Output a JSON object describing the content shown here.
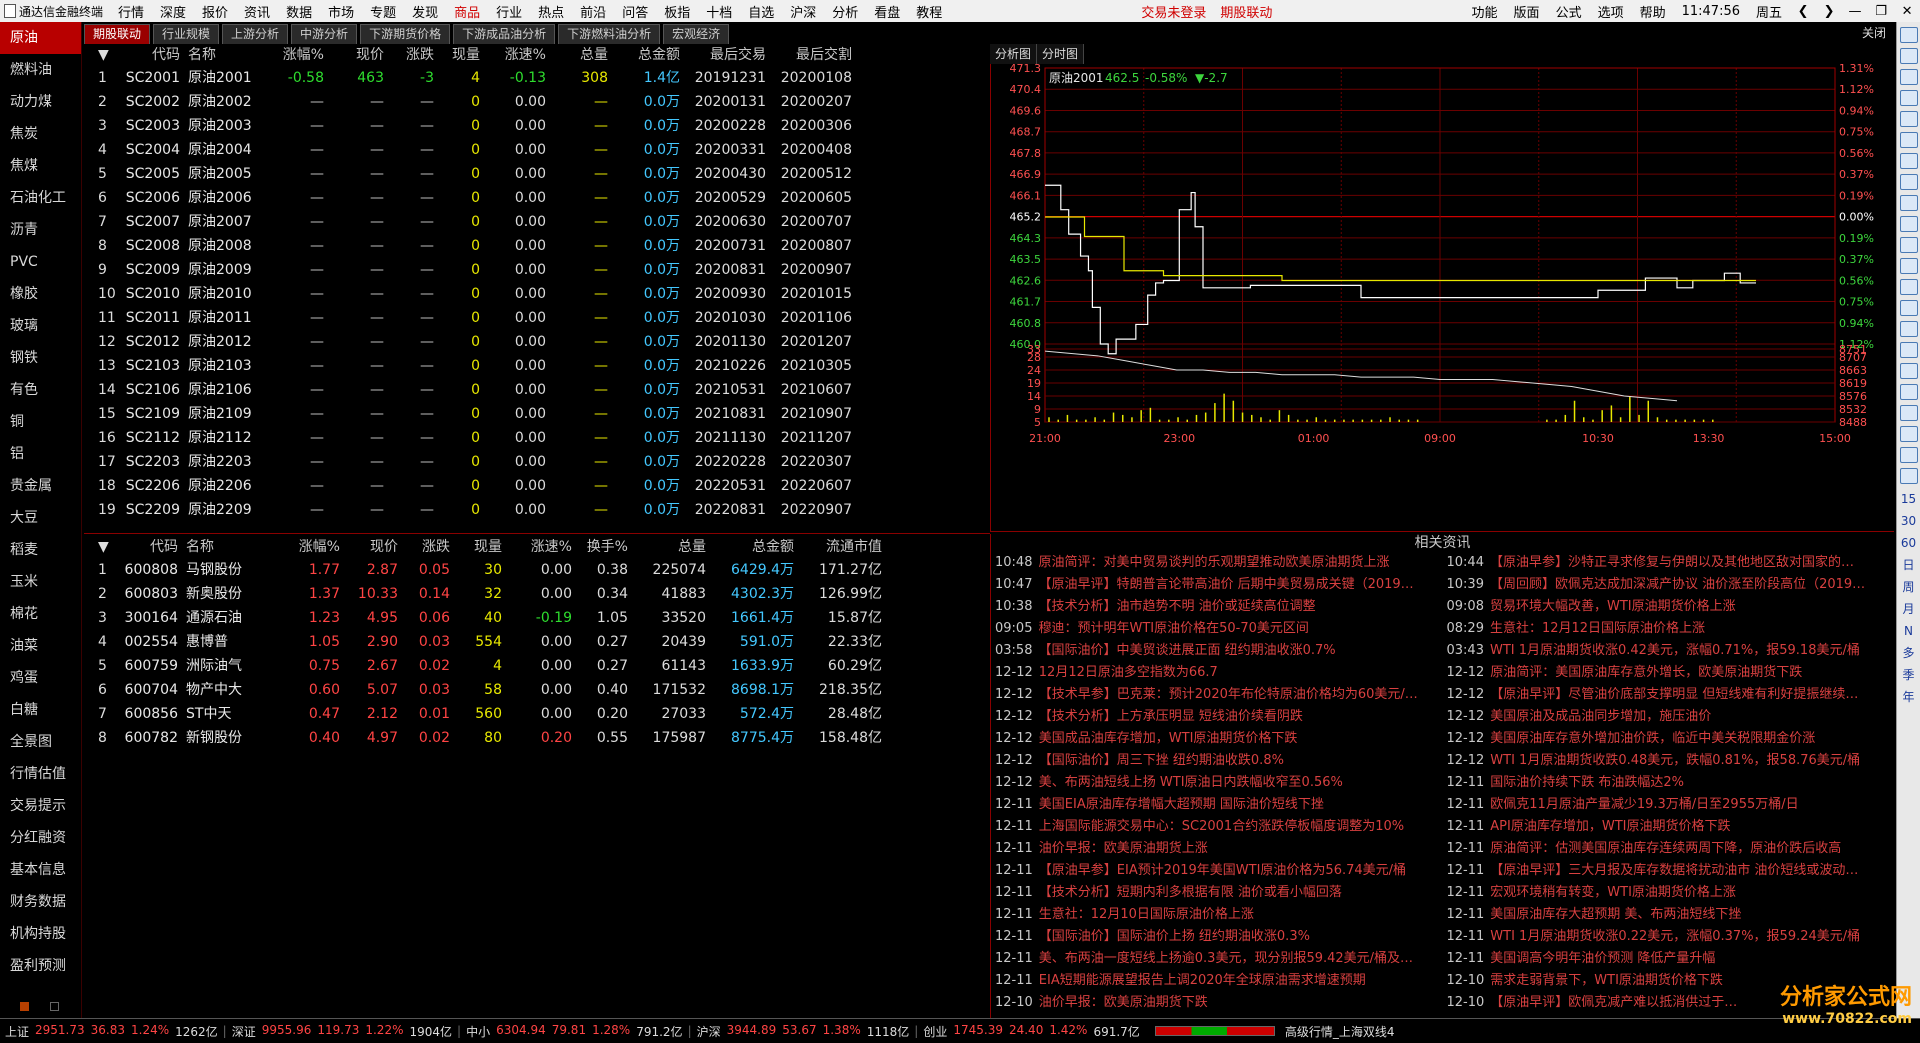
{
  "app": {
    "title": "通达信金融终端"
  },
  "menu": [
    "行情",
    "深度",
    "报价",
    "资讯",
    "数据",
    "市场",
    "专题",
    "发现",
    "商品",
    "行业",
    "热点",
    "前沿",
    "问答",
    "板指",
    "十档",
    "自选",
    "沪深",
    "分析",
    "看盘",
    "教程"
  ],
  "menu_active": "商品",
  "status_right": [
    "交易未登录",
    "期股联动"
  ],
  "menu_right": [
    "功能",
    "版面",
    "公式",
    "选项",
    "帮助"
  ],
  "clock": "11:47:56",
  "weekday": "周五",
  "left_nav": [
    "原油",
    "燃料油",
    "动力煤",
    "焦炭",
    "焦煤",
    "石油化工",
    "沥青",
    "PVC",
    "橡胶",
    "玻璃",
    "钢铁",
    "有色",
    "铜",
    "铝",
    "贵金属",
    "大豆",
    "稻麦",
    "玉米",
    "棉花",
    "油菜",
    "鸡蛋",
    "白糖",
    "全景图",
    "行情估值",
    "交易提示",
    "分红融资",
    "基本信息",
    "财务数据",
    "机构持股",
    "盈利预测"
  ],
  "left_nav_active": "原油",
  "tabs": [
    "期股联动",
    "行业规模",
    "上游分析",
    "中游分析",
    "下游期货价格",
    "下游成品油分析",
    "下游燃料油分析",
    "宏观经济"
  ],
  "tab_active": "期股联动",
  "close_label": "关闭",
  "futures_table": {
    "headers": [
      "",
      "代码",
      "名称",
      "涨幅%",
      "现价",
      "涨跌",
      "现量",
      "涨速%",
      "总量",
      "总金额",
      "最后交易",
      "最后交割"
    ],
    "rows": [
      [
        "1",
        "SC2001",
        "原油2001",
        "-0.58",
        "463",
        "-3",
        "4",
        "-0.13",
        "308",
        "1.4亿",
        "20191231",
        "20200108"
      ],
      [
        "2",
        "SC2002",
        "原油2002",
        "—",
        "—",
        "—",
        "0",
        "0.00",
        "—",
        "0.0万",
        "20200131",
        "20200207"
      ],
      [
        "3",
        "SC2003",
        "原油2003",
        "—",
        "—",
        "—",
        "0",
        "0.00",
        "—",
        "0.0万",
        "20200228",
        "20200306"
      ],
      [
        "4",
        "SC2004",
        "原油2004",
        "—",
        "—",
        "—",
        "0",
        "0.00",
        "—",
        "0.0万",
        "20200331",
        "20200408"
      ],
      [
        "5",
        "SC2005",
        "原油2005",
        "—",
        "—",
        "—",
        "0",
        "0.00",
        "—",
        "0.0万",
        "20200430",
        "20200512"
      ],
      [
        "6",
        "SC2006",
        "原油2006",
        "—",
        "—",
        "—",
        "0",
        "0.00",
        "—",
        "0.0万",
        "20200529",
        "20200605"
      ],
      [
        "7",
        "SC2007",
        "原油2007",
        "—",
        "—",
        "—",
        "0",
        "0.00",
        "—",
        "0.0万",
        "20200630",
        "20200707"
      ],
      [
        "8",
        "SC2008",
        "原油2008",
        "—",
        "—",
        "—",
        "0",
        "0.00",
        "—",
        "0.0万",
        "20200731",
        "20200807"
      ],
      [
        "9",
        "SC2009",
        "原油2009",
        "—",
        "—",
        "—",
        "0",
        "0.00",
        "—",
        "0.0万",
        "20200831",
        "20200907"
      ],
      [
        "10",
        "SC2010",
        "原油2010",
        "—",
        "—",
        "—",
        "0",
        "0.00",
        "—",
        "0.0万",
        "20200930",
        "20201015"
      ],
      [
        "11",
        "SC2011",
        "原油2011",
        "—",
        "—",
        "—",
        "0",
        "0.00",
        "—",
        "0.0万",
        "20201030",
        "20201106"
      ],
      [
        "12",
        "SC2012",
        "原油2012",
        "—",
        "—",
        "—",
        "0",
        "0.00",
        "—",
        "0.0万",
        "20201130",
        "20201207"
      ],
      [
        "13",
        "SC2103",
        "原油2103",
        "—",
        "—",
        "—",
        "0",
        "0.00",
        "—",
        "0.0万",
        "20210226",
        "20210305"
      ],
      [
        "14",
        "SC2106",
        "原油2106",
        "—",
        "—",
        "—",
        "0",
        "0.00",
        "—",
        "0.0万",
        "20210531",
        "20210607"
      ],
      [
        "15",
        "SC2109",
        "原油2109",
        "—",
        "—",
        "—",
        "0",
        "0.00",
        "—",
        "0.0万",
        "20210831",
        "20210907"
      ],
      [
        "16",
        "SC2112",
        "原油2112",
        "—",
        "—",
        "—",
        "0",
        "0.00",
        "—",
        "0.0万",
        "20211130",
        "20211207"
      ],
      [
        "17",
        "SC2203",
        "原油2203",
        "—",
        "—",
        "—",
        "0",
        "0.00",
        "—",
        "0.0万",
        "20220228",
        "20220307"
      ],
      [
        "18",
        "SC2206",
        "原油2206",
        "—",
        "—",
        "—",
        "0",
        "0.00",
        "—",
        "0.0万",
        "20220531",
        "20220607"
      ],
      [
        "19",
        "SC2209",
        "原油2209",
        "—",
        "—",
        "—",
        "0",
        "0.00",
        "—",
        "0.0万",
        "20220831",
        "20220907"
      ]
    ]
  },
  "stocks_table": {
    "headers": [
      "",
      "代码",
      "名称",
      "涨幅%",
      "现价",
      "涨跌",
      "现量",
      "涨速%",
      "换手%",
      "总量",
      "总金额",
      "流通市值"
    ],
    "rows": [
      [
        "1",
        "600808",
        "马钢股份",
        "1.77",
        "2.87",
        "0.05",
        "30",
        "0.00",
        "0.38",
        "225074",
        "6429.4万",
        "171.27亿"
      ],
      [
        "2",
        "600803",
        "新奥股份",
        "1.37",
        "10.33",
        "0.14",
        "32",
        "0.00",
        "0.34",
        "41883",
        "4302.3万",
        "126.99亿"
      ],
      [
        "3",
        "300164",
        "通源石油",
        "1.23",
        "4.95",
        "0.06",
        "40",
        "-0.19",
        "1.05",
        "33520",
        "1661.4万",
        "15.87亿"
      ],
      [
        "4",
        "002554",
        "惠博普",
        "1.05",
        "2.90",
        "0.03",
        "554",
        "0.00",
        "0.27",
        "20439",
        "591.0万",
        "22.33亿"
      ],
      [
        "5",
        "600759",
        "洲际油气",
        "0.75",
        "2.67",
        "0.02",
        "4",
        "0.00",
        "0.27",
        "61143",
        "1633.9万",
        "60.29亿"
      ],
      [
        "6",
        "600704",
        "物产中大",
        "0.60",
        "5.07",
        "0.03",
        "58",
        "0.00",
        "0.40",
        "171532",
        "8698.1万",
        "218.35亿"
      ],
      [
        "7",
        "600856",
        "ST中天",
        "0.47",
        "2.12",
        "0.01",
        "560",
        "0.00",
        "0.20",
        "27033",
        "572.4万",
        "28.48亿"
      ],
      [
        "8",
        "600782",
        "新钢股份",
        "0.40",
        "4.97",
        "0.02",
        "80",
        "0.20",
        "0.55",
        "175987",
        "8775.4万",
        "158.48亿"
      ]
    ]
  },
  "chart_tabs": [
    "分析图",
    "分时图"
  ],
  "chart_header": {
    "name": "原油2001",
    "price": "462.5",
    "change_pct": "-0.58%",
    "change": "▼-2.7"
  },
  "chart_data": {
    "type": "line",
    "title": "原油2001",
    "x_ticks": [
      "21:00",
      "23:00",
      "01:00",
      "09:00",
      "10:30",
      "13:30",
      "15:00"
    ],
    "price_ticks": [
      "471.3",
      "470.4",
      "469.6",
      "468.7",
      "467.8",
      "466.9",
      "466.1",
      "465.2",
      "464.3",
      "463.5",
      "462.6",
      "461.7",
      "460.8",
      "460.0"
    ],
    "pct_ticks": [
      "1.31%",
      "1.12%",
      "0.94%",
      "0.75%",
      "0.56%",
      "0.37%",
      "0.19%",
      "0.00%",
      "0.19%",
      "0.37%",
      "0.56%",
      "0.75%",
      "0.94%",
      "1.12%"
    ],
    "volume_ticks": [
      "33",
      "28",
      "24",
      "19",
      "14",
      "9",
      "5"
    ],
    "oi_ticks": [
      "8751",
      "8707",
      "8663",
      "8619",
      "8576",
      "8532",
      "8488"
    ],
    "ylim_price": [
      460.0,
      471.3
    ],
    "series": [
      {
        "name": "价格",
        "color": "#ffffff",
        "x": [
          0,
          0.02,
          0.03,
          0.045,
          0.055,
          0.06,
          0.07,
          0.08,
          0.09,
          0.1,
          0.115,
          0.13,
          0.14,
          0.15,
          0.17,
          0.185,
          0.19,
          0.2,
          0.25,
          0.26,
          0.3,
          0.31,
          0.4,
          0.45,
          0.55,
          0.6,
          0.67,
          0.7,
          0.74,
          0.76,
          0.77,
          0.8,
          0.82,
          0.86,
          0.88,
          0.9
        ],
        "y": [
          466.5,
          465.5,
          464.5,
          463.6,
          463.0,
          461.5,
          460.0,
          459.6,
          460.2,
          460.2,
          460.8,
          462.0,
          462.5,
          462.6,
          465.5,
          466.2,
          464.8,
          462.3,
          462.3,
          462.4,
          462.4,
          462.4,
          461.9,
          461.9,
          461.9,
          461.9,
          461.9,
          462.2,
          462.2,
          462.7,
          462.7,
          462.3,
          462.6,
          462.9,
          462.5,
          462.5
        ]
      },
      {
        "name": "均价",
        "color": "#e8e800",
        "x": [
          0,
          0.05,
          0.1,
          0.15,
          0.3,
          0.6,
          0.9
        ],
        "y": [
          465.2,
          464.4,
          463.0,
          462.8,
          462.6,
          462.6,
          462.6
        ]
      }
    ],
    "volume": [
      2,
      1,
      3,
      1,
      1,
      2,
      1,
      4,
      3,
      2,
      5,
      6,
      1,
      1,
      2,
      1,
      3,
      4,
      8,
      12,
      9,
      4,
      3,
      2,
      1,
      5,
      3,
      1,
      1,
      2,
      1,
      1,
      1,
      1,
      1,
      1,
      1,
      2,
      1,
      1,
      1,
      1,
      1,
      3,
      9,
      2,
      1,
      5,
      7,
      2,
      11,
      3,
      9,
      2,
      1,
      1,
      1,
      1,
      1,
      1
    ],
    "open_interest_line": [
      30,
      29,
      28,
      26,
      24,
      22,
      22,
      21,
      21,
      20,
      20,
      20,
      19,
      19,
      19,
      18,
      18,
      18,
      17,
      16,
      15,
      13,
      11,
      10,
      9
    ]
  },
  "news": {
    "title": "相关资讯",
    "left": [
      [
        "10:48",
        "原油简评：对美中贸易谈判的乐观期望推动欧美原油期货上涨"
      ],
      [
        "10:47",
        "【原油早评】特朗普言论带高油价 后期中美贸易成关键（2019…"
      ],
      [
        "10:38",
        "【技术分析】油市趋势不明 油价或延续高位调整"
      ],
      [
        "09:05",
        "穆迪：预计明年WTI原油价格在50-70美元区间"
      ],
      [
        "03:58",
        "【国际油价】中美贸谈进展正面 纽约期油收涨0.7%"
      ],
      [
        "12-12",
        "12月12日原油多空指数为66.7"
      ],
      [
        "12-12",
        "【技术早参】巴克莱：预计2020年布伦特原油价格均为60美元/…"
      ],
      [
        "12-12",
        "【技术分析】上方承压明显 短线油价续看阴跌"
      ],
      [
        "12-12",
        "美国成品油库存增加，WTI原油期货价格下跌"
      ],
      [
        "12-12",
        "【国际油价】周三下挫 纽约期油收跌0.8%"
      ],
      [
        "12-12",
        "美、布两油短线上扬 WTI原油日内跌幅收窄至0.56%"
      ],
      [
        "12-11",
        "美国EIA原油库存增幅大超预期 国际油价短线下挫"
      ],
      [
        "12-11",
        "上海国际能源交易中心：SC2001合约涨跌停板幅度调整为10%"
      ],
      [
        "12-11",
        "油价早报：欧美原油期货上涨"
      ],
      [
        "12-11",
        "【原油早参】EIA预计2019年美国WTI原油价格为56.74美元/桶"
      ],
      [
        "12-11",
        "【技术分析】短期内利多根据有限 油价或看小幅回落"
      ],
      [
        "12-11",
        "生意社：12月10日国际原油价格上涨"
      ],
      [
        "12-11",
        "【国际油价】国际油价上扬 纽约期油收涨0.3%"
      ],
      [
        "12-11",
        "美、布两油一度短线上扬逾0.3美元，现分别报59.42美元/桶及…"
      ],
      [
        "12-11",
        "EIA短期能源展望报告上调2020年全球原油需求增速预期"
      ],
      [
        "12-10",
        "油价早报：欧美原油期货下跌"
      ]
    ],
    "right": [
      [
        "10:44",
        "【原油早参】沙特正寻求修复与伊朗以及其他地区敌对国家的…"
      ],
      [
        "10:39",
        "【周回顾】欧佩克达成加深减产协议 油价涨至阶段高位（2019…"
      ],
      [
        "09:08",
        "贸易环境大幅改善，WTI原油期货价格上涨"
      ],
      [
        "08:29",
        "生意社：12月12日国际原油价格上涨"
      ],
      [
        "03:43",
        "WTI 1月原油期货收涨0.42美元，涨幅0.71%，报59.18美元/桶"
      ],
      [
        "12-12",
        "原油简评：美国原油库存意外增长，欧美原油期货下跌"
      ],
      [
        "12-12",
        "【原油早评】尽管油价底部支撑明显 但短线难有利好提振继续…"
      ],
      [
        "12-12",
        "美国原油及成品油同步增加，施压油价"
      ],
      [
        "12-12",
        "美国原油库存意外增加油价跌，临近中美关税限期金价涨"
      ],
      [
        "12-12",
        "WTI 1月原油期货收跌0.48美元，跌幅0.81%，报58.76美元/桶"
      ],
      [
        "12-11",
        "国际油价持续下跌 布油跌幅达2%"
      ],
      [
        "12-11",
        "欧佩克11月原油产量减少19.3万桶/日至2955万桶/日"
      ],
      [
        "12-11",
        "API原油库存增加，WTI原油期货价格下跌"
      ],
      [
        "12-11",
        "原油简评：估测美国原油库存连续两周下降，原油价跌后收高"
      ],
      [
        "12-11",
        "【原油早评】三大月报及库存数据将扰动油市 油价短线或波动…"
      ],
      [
        "12-11",
        "宏观环境稍有转变，WTI原油期货价格上涨"
      ],
      [
        "12-11",
        "美国原油库存大超预期 美、布两油短线下挫"
      ],
      [
        "12-11",
        "WTI 1月原油期货收涨0.22美元，涨幅0.37%，报59.24美元/桶"
      ],
      [
        "12-11",
        "美国调高今明年油价预测 降低产量升幅"
      ],
      [
        "12-10",
        "需求走弱背景下，WTI原油期货价格下跌"
      ],
      [
        "12-10",
        "【原油早评】欧佩克减产难以抵消供过于…"
      ]
    ]
  },
  "right_toolbar_text": [
    "15",
    "30",
    "60",
    "日",
    "周",
    "月",
    "N",
    "多",
    "季",
    "年"
  ],
  "statusbar": [
    {
      "name": "上证",
      "v": "2951.73",
      "c": "36.83",
      "p": "1.24%",
      "a": "1262亿"
    },
    {
      "name": "深证",
      "v": "9955.96",
      "c": "119.73",
      "p": "1.22%",
      "a": "1904亿"
    },
    {
      "name": "中小",
      "v": "6304.94",
      "c": "79.81",
      "p": "1.28%",
      "a": "791.2亿"
    },
    {
      "name": "沪深",
      "v": "3944.89",
      "c": "53.67",
      "p": "1.38%",
      "a": "1118亿"
    },
    {
      "name": "创业",
      "v": "1745.39",
      "c": "24.40",
      "p": "1.42%",
      "a": "691.7亿"
    }
  ],
  "status_tail": "高级行情_上海双线4",
  "watermark": {
    "main": "分析家公式网",
    "url": "www.70822.com"
  }
}
